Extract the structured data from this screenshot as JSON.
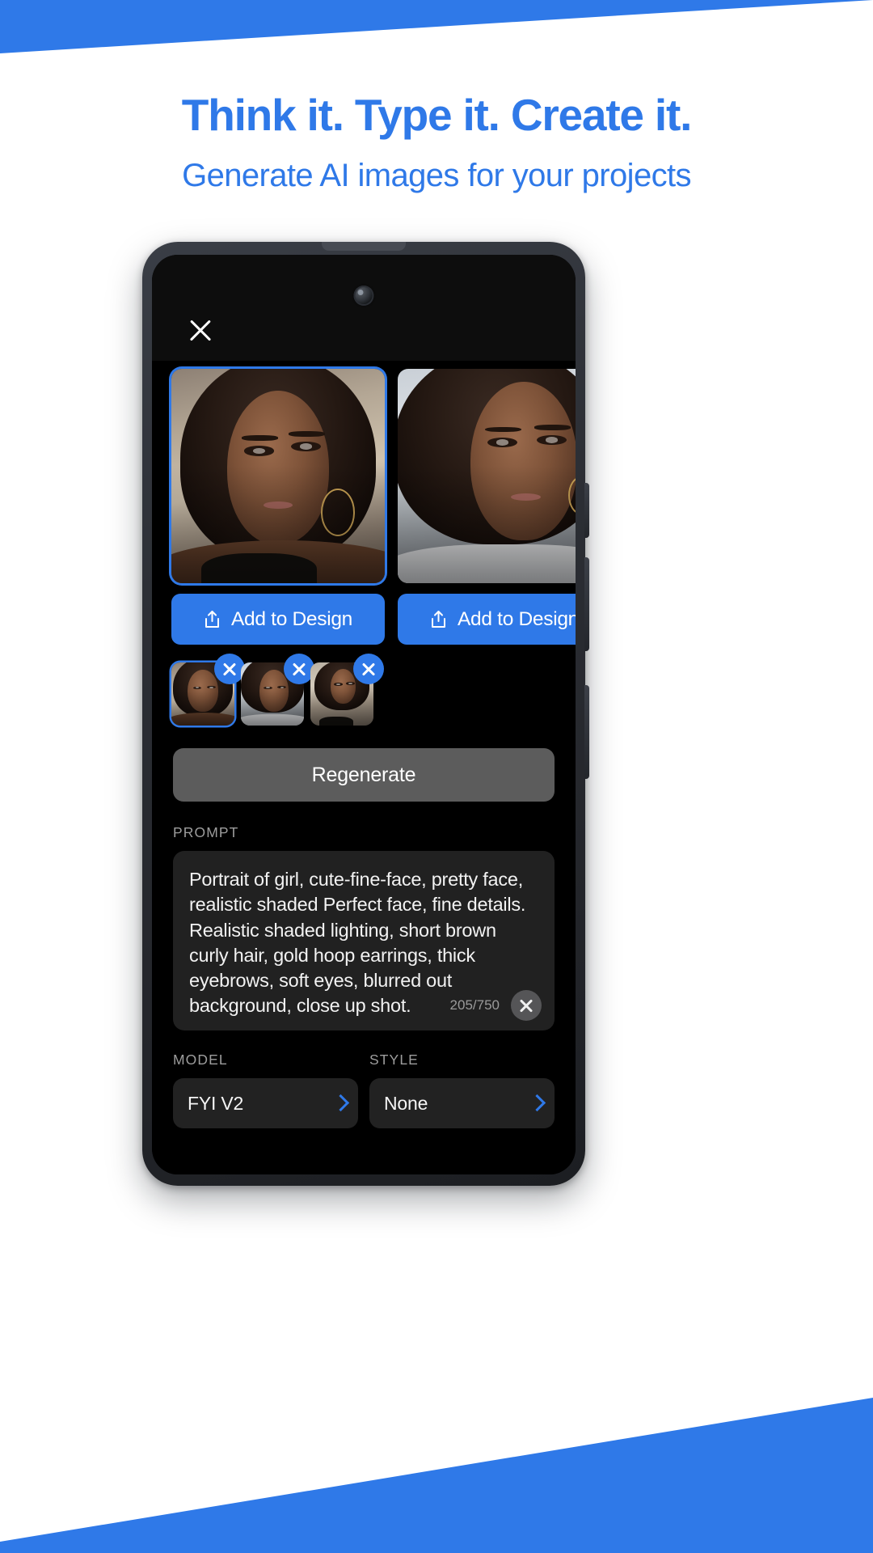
{
  "hero": {
    "headline": "Think it. Type it. Create it.",
    "subheadline": "Generate AI images for your projects",
    "accent_color": "#2f79e8"
  },
  "app": {
    "close_icon": "close-icon",
    "results": [
      {
        "id": 1,
        "selected": true,
        "add_button_label": "Add to Design",
        "icon": "share-upload-icon"
      },
      {
        "id": 2,
        "selected": false,
        "add_button_label": "Add to Design",
        "icon": "share-upload-icon"
      }
    ],
    "thumbnails": [
      {
        "id": 1,
        "selected": true,
        "remove_icon": "close-circle-icon"
      },
      {
        "id": 2,
        "selected": false,
        "remove_icon": "close-circle-icon"
      },
      {
        "id": 3,
        "selected": false,
        "remove_icon": "close-circle-icon"
      }
    ],
    "regenerate_label": "Regenerate",
    "prompt": {
      "label": "PROMPT",
      "value": "Portrait of girl, cute-fine-face, pretty face, realistic shaded Perfect face, fine details. Realistic shaded lighting, short brown curly hair, gold hoop earrings, thick eyebrows, soft eyes, blurred out background, close up shot.",
      "char_count": "205/750",
      "clear_icon": "close-icon"
    },
    "model": {
      "label": "MODEL",
      "value": "FYI V2",
      "chevron_icon": "chevron-right-icon"
    },
    "style": {
      "label": "STYLE",
      "value": "None",
      "chevron_icon": "chevron-right-icon"
    }
  }
}
